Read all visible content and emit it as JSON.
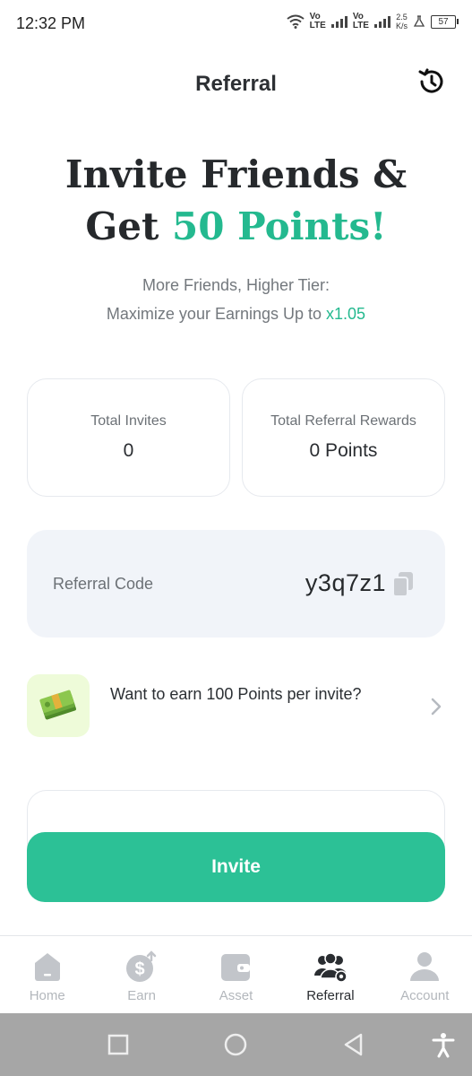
{
  "status_bar": {
    "time": "12:32 PM",
    "net1_top": "Vo",
    "net1_bottom": "LTE",
    "net2_top": "Vo",
    "net2_bottom": "LTE",
    "speed_top": "2.5",
    "speed_bottom": "K/s",
    "battery": "57"
  },
  "header": {
    "title": "Referral",
    "history_icon": "history-icon"
  },
  "hero": {
    "title_line1": "Invite Friends &",
    "title_line2_prefix": "Get",
    "title_line2_accent": "50 Points!",
    "subtitle_line1": "More Friends, Higher Tier:",
    "subtitle_line2_prefix": "Maximize your Earnings Up to",
    "subtitle_multiplier": "x1.05"
  },
  "stats": {
    "invites_label": "Total Invites",
    "invites_value": "0",
    "rewards_label": "Total Referral Rewards",
    "rewards_value": "0 Points"
  },
  "referral_code": {
    "label": "Referral Code",
    "value": "y3q7z1",
    "copy_icon": "copy-icon"
  },
  "earn_more": {
    "text": "Want to earn 100 Points per invite?",
    "icon": "money-icon"
  },
  "invite_button": {
    "label": "Invite"
  },
  "nav": {
    "items": [
      {
        "label": "Home",
        "icon": "home-icon"
      },
      {
        "label": "Earn",
        "icon": "earn-icon"
      },
      {
        "label": "Asset",
        "icon": "wallet-icon"
      },
      {
        "label": "Referral",
        "icon": "referral-icon",
        "active": true
      },
      {
        "label": "Account",
        "icon": "account-icon"
      }
    ]
  },
  "colors": {
    "accent": "#2cc196",
    "accent_text": "#24b98f",
    "card_bg": "#f1f4f9",
    "money_bg": "#eefbd9"
  }
}
